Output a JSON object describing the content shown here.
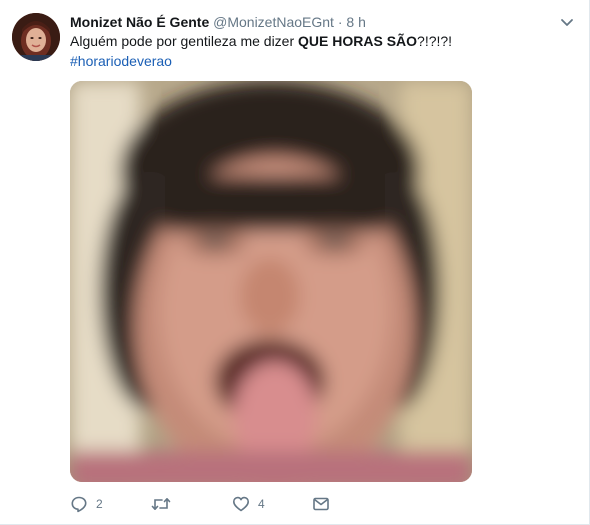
{
  "tweet": {
    "fullname": "Monizet Não É Gente",
    "handle": "@MonizetNaoEGnt",
    "separator": "·",
    "time": "8 h",
    "text_before": "Alguém pode por gentileza me dizer ",
    "text_bold": "QUE HORAS SÃO",
    "text_after": "?!?!?!",
    "hashtag": "#horariodeverao",
    "colors": {
      "name": "#14171a",
      "secondary": "#657786",
      "hashtag": "#1b5fb5"
    },
    "icons": {
      "avatar": "profile-photo",
      "caret": "chevron-down-icon",
      "media": "blurred-face-photo",
      "reply": "reply-icon",
      "retweet": "retweet-icon",
      "like": "heart-icon",
      "dm": "envelope-icon"
    },
    "actions": {
      "reply_count": "2",
      "retweet_count": "",
      "like_count": "4"
    }
  }
}
